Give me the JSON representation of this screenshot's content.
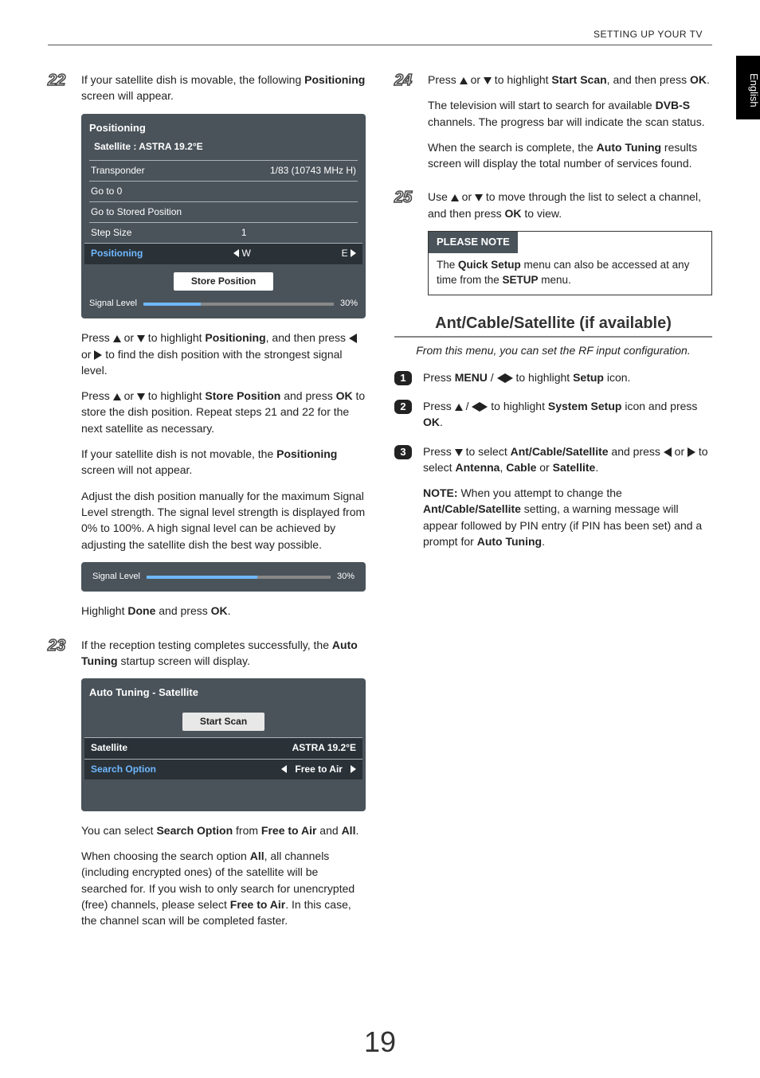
{
  "header": {
    "section": "SETTING UP YOUR TV",
    "language_tab": "English"
  },
  "steps": {
    "s22": {
      "num": "22",
      "intro_a": "If your satellite dish is movable, the following ",
      "intro_b": "Positioning",
      "intro_c": " screen will appear.",
      "panel": {
        "title": "Positioning",
        "subtitle": "Satellite : ASTRA 19.2°E",
        "rows": {
          "transponder": {
            "label": "Transponder",
            "value": "1/83 (10743 MHz  H)"
          },
          "goto0": {
            "label": "Go to 0"
          },
          "stored": {
            "label": "Go to Stored Position"
          },
          "stepsize": {
            "label": "Step Size",
            "value": "1"
          },
          "positioning": {
            "label": "Positioning",
            "left": "W",
            "right": "E"
          }
        },
        "button": "Store Position",
        "signal": {
          "label": "Signal Level",
          "pct": "30%",
          "fill": 30
        }
      },
      "p1a": "Press ",
      "p1b": " or ",
      "p1c": " to highlight ",
      "p1d": "Positioning",
      "p1e": ", and then press ",
      "p1f": " or ",
      "p1g": " to find the dish position with the strongest signal level.",
      "p2a": "Press ",
      "p2b": " or ",
      "p2c": " to highlight ",
      "p2d": "Store Position",
      "p2e": " and press ",
      "p2f": "OK",
      "p2g": " to store the dish position. Repeat steps 21 and 22 for the next satellite as necessary.",
      "p3a": "If your satellite dish is not movable, the ",
      "p3b": "Positioning",
      "p3c": " screen will not appear.",
      "p4": "Adjust the dish position manually for the maximum Signal Level strength. The signal level strength is displayed from 0% to 100%. A high signal level can be achieved by adjusting the satellite dish the best way possible.",
      "signalbar": {
        "label": "Signal Level",
        "pct": "30%",
        "fill": 60
      },
      "p5a": "Highlight ",
      "p5b": "Done",
      "p5c": " and press ",
      "p5d": "OK",
      "p5e": "."
    },
    "s23": {
      "num": "23",
      "p1a": "If the reception testing completes successfully, the ",
      "p1b": "Auto Tuning",
      "p1c": " startup screen will display.",
      "panel": {
        "title": "Auto Tuning - Satellite",
        "button": "Start Scan",
        "rows": {
          "satellite": {
            "label": "Satellite",
            "value": "ASTRA 19.2°E"
          },
          "search": {
            "label": "Search Option",
            "value": "Free to Air"
          }
        }
      },
      "p2a": "You can select ",
      "p2b": "Search Option",
      "p2c": " from ",
      "p2d": "Free to Air",
      "p2e": " and ",
      "p2f": "All",
      "p2g": ".",
      "p3a": "When choosing the search option ",
      "p3b": "All",
      "p3c": ", all channels (including encrypted ones) of the satellite will be searched for. If you wish to only search for unencrypted (free) channels, please select ",
      "p3d": "Free to Air",
      "p3e": ". In this case, the channel scan will be completed faster."
    },
    "s24": {
      "num": "24",
      "p1a": "Press ",
      "p1b": " or ",
      "p1c": " to highlight ",
      "p1d": "Start Scan",
      "p1e": ", and then press ",
      "p1f": "OK",
      "p1g": ".",
      "p2a": "The television will start to search for available ",
      "p2b": "DVB-S",
      "p2c": " channels. The progress bar will indicate the scan status.",
      "p3a": "When the search is complete, the ",
      "p3b": "Auto Tuning",
      "p3c": " results screen will display the total number of services found."
    },
    "s25": {
      "num": "25",
      "p1a": "Use ",
      "p1b": " or ",
      "p1c": " to move through the list to select a channel, and then press ",
      "p1d": "OK",
      "p1e": " to view."
    },
    "note": {
      "head": "PLEASE NOTE",
      "body_a": "The ",
      "body_b": "Quick Setup",
      "body_c": " menu can also be accessed at any time from the ",
      "body_d": "SETUP",
      "body_e": " menu."
    }
  },
  "section2": {
    "heading": "Ant/Cable/Satellite (if available)",
    "caption": "From this menu, you can set the RF input configuration.",
    "s1": {
      "num": "1",
      "a": "Press ",
      "b": "MENU",
      "c": " / ",
      "d": " to highlight ",
      "e": "Setup",
      "f": " icon."
    },
    "s2": {
      "num": "2",
      "a": "Press ",
      "b": " / ",
      "c": " to highlight ",
      "d": "System Setup",
      "e": " icon and press ",
      "f": "OK",
      "g": "."
    },
    "s3": {
      "num": "3",
      "a": "Press ",
      "b": " to select ",
      "c": "Ant/Cable/Satellite",
      "d": " and press ",
      "e": " or ",
      "f": " to select ",
      "g": "Antenna",
      "h": ", ",
      "i": "Cable",
      "j": " or ",
      "k": "Satellite",
      "l": ".",
      "note_a": "NOTE:",
      "note_b": " When you attempt to change the ",
      "note_c": "Ant/Cable/Satellite",
      "note_d": " setting, a warning message will appear followed by PIN entry (if PIN has been set) and a prompt for ",
      "note_e": "Auto Tuning",
      "note_f": "."
    }
  },
  "page_number": "19"
}
